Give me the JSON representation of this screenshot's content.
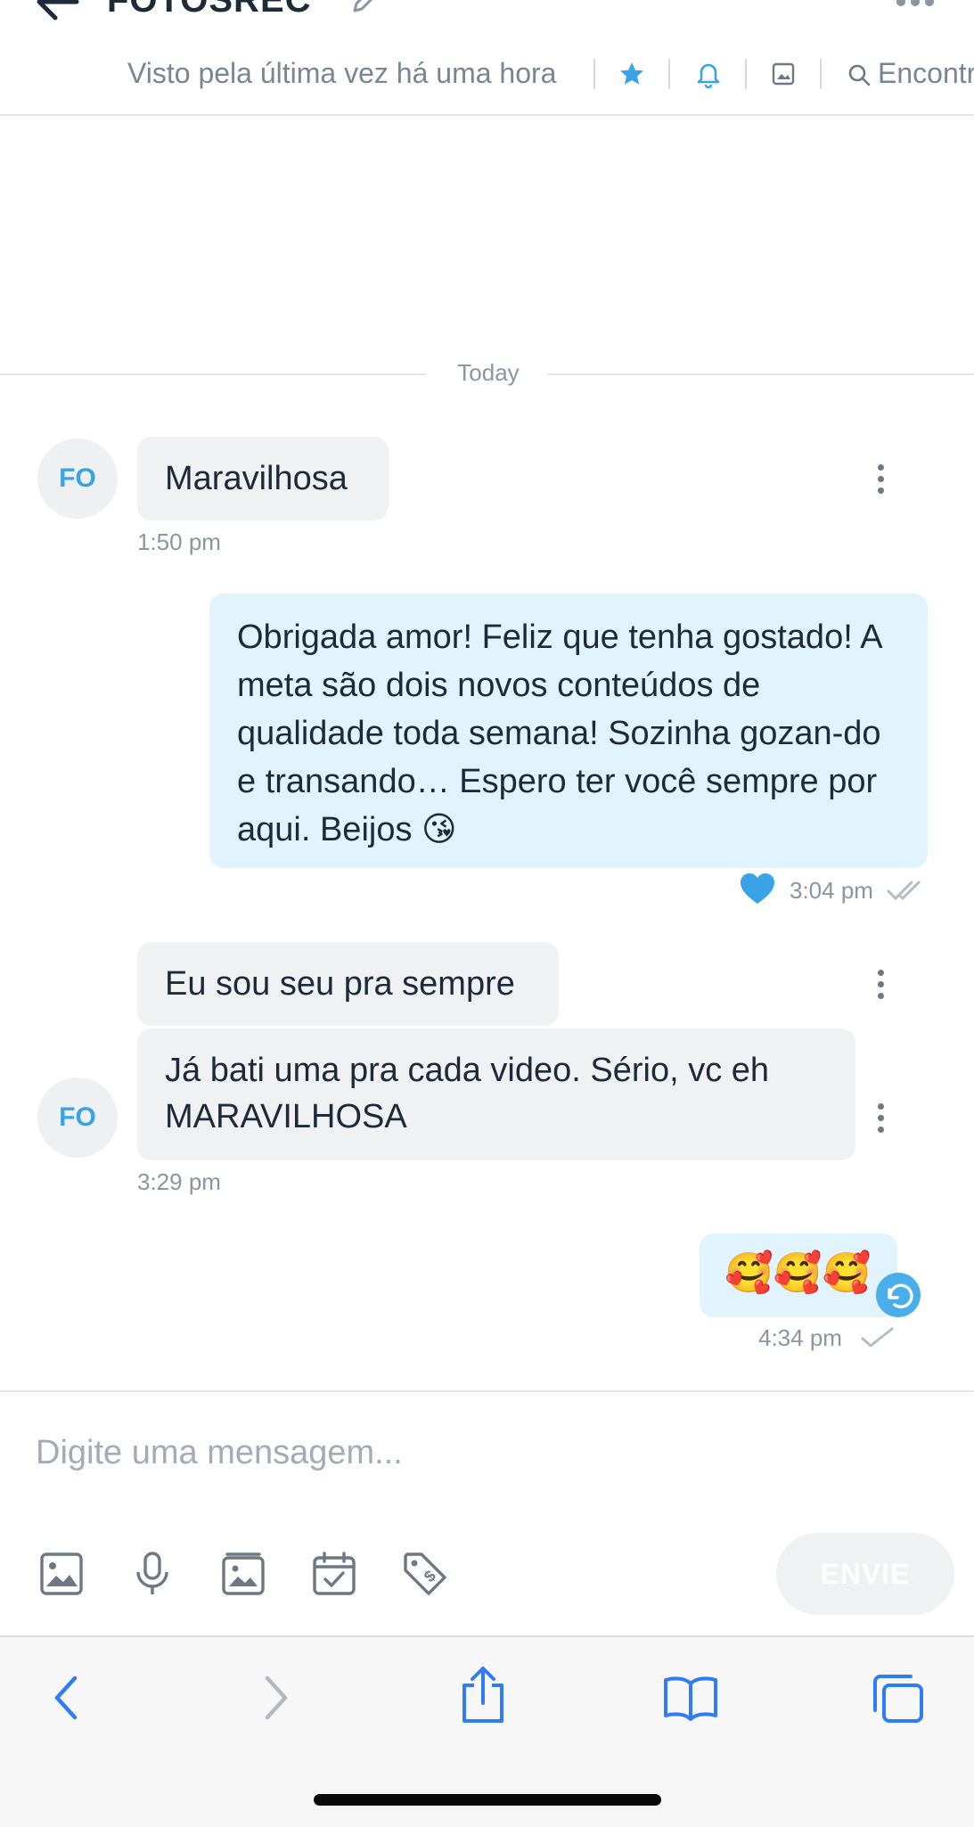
{
  "header": {
    "title": "FOTOSREC",
    "last_seen": "Visto pela última vez há uma hora",
    "find_label": "Encontr",
    "colors": {
      "accent": "#3aa3e6",
      "muted": "#7a8593"
    }
  },
  "chat": {
    "day_label": "Today",
    "avatar_initials": "FO",
    "messages": [
      {
        "direction": "in",
        "text": "Maravilhosa",
        "time": "1:50 pm"
      },
      {
        "direction": "out",
        "text": "Obrigada amor! Feliz que tenha gostado! A meta são dois novos conteúdos de qualidade toda semana! Sozinha gozan-do e transando… Espero ter você sempre por aqui. Beijos 😘",
        "time": "3:04 pm",
        "liked": true,
        "status": "read"
      },
      {
        "direction": "in",
        "text": "Eu sou seu pra sempre"
      },
      {
        "direction": "in",
        "text": "Já bati uma pra cada video. Sério, vc eh MARAVILHOSA",
        "time": "3:29 pm"
      },
      {
        "direction": "out",
        "text": "🥰🥰🥰",
        "time": "4:34 pm",
        "status": "sent"
      }
    ]
  },
  "composer": {
    "placeholder": "Digite uma mensagem...",
    "send_label": "ENVIE",
    "tools": [
      "image-icon",
      "microphone-icon",
      "vault-icon",
      "schedule-icon",
      "price-tag-icon"
    ]
  },
  "browser": {
    "icons": [
      "back-icon",
      "forward-icon",
      "share-icon",
      "bookmarks-icon",
      "tabs-icon"
    ]
  }
}
